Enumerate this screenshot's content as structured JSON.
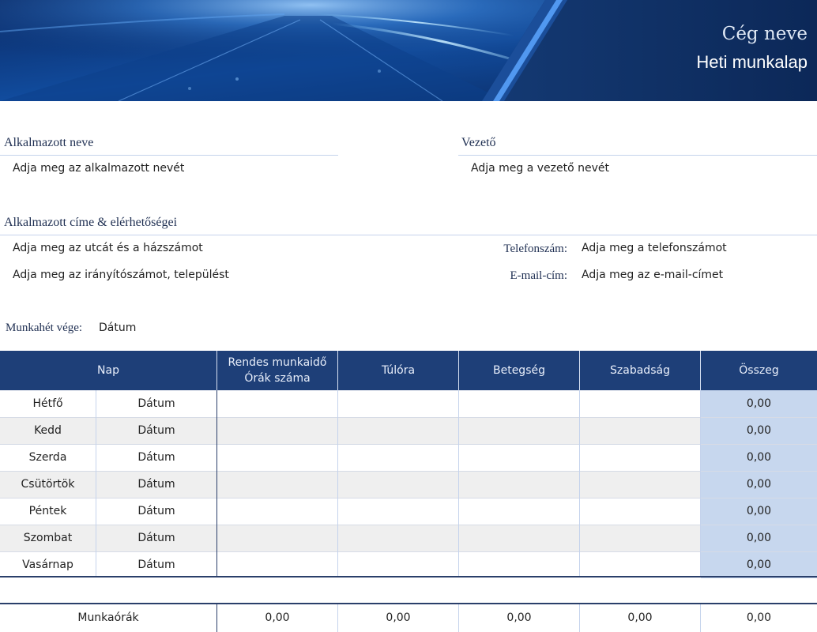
{
  "header": {
    "company_name": "Cég neve",
    "title": "Heti munkalap"
  },
  "employee": {
    "label": "Alkalmazott neve",
    "value": "Adja meg az alkalmazott nevét"
  },
  "manager": {
    "label": "Vezető",
    "value": "Adja meg a vezető nevét"
  },
  "contact": {
    "label": "Alkalmazott címe & elérhetőségei",
    "street": "Adja meg az utcát és a házszámot",
    "city": "Adja meg az irányítószámot, települést",
    "phone_label": "Telefonszám:",
    "phone_value": "Adja meg a telefonszámot",
    "email_label": "E-mail-cím:",
    "email_value": "Adja meg az e-mail-címet"
  },
  "week_end": {
    "label": "Munkahét vége:",
    "value": "Dátum"
  },
  "table": {
    "headers": {
      "day": "Nap",
      "regular_line1": "Rendes munkaidő",
      "regular_line2": "Órák száma",
      "overtime": "Túlóra",
      "sick": "Betegség",
      "vacation": "Szabadság",
      "total": "Összeg"
    },
    "rows": [
      {
        "day": "Hétfő",
        "date": "Dátum",
        "regular": "",
        "overtime": "",
        "sick": "",
        "vacation": "",
        "total": "0,00"
      },
      {
        "day": "Kedd",
        "date": "Dátum",
        "regular": "",
        "overtime": "",
        "sick": "",
        "vacation": "",
        "total": "0,00"
      },
      {
        "day": "Szerda",
        "date": "Dátum",
        "regular": "",
        "overtime": "",
        "sick": "",
        "vacation": "",
        "total": "0,00"
      },
      {
        "day": "Csütörtök",
        "date": "Dátum",
        "regular": "",
        "overtime": "",
        "sick": "",
        "vacation": "",
        "total": "0,00"
      },
      {
        "day": "Péntek",
        "date": "Dátum",
        "regular": "",
        "overtime": "",
        "sick": "",
        "vacation": "",
        "total": "0,00"
      },
      {
        "day": "Szombat",
        "date": "Dátum",
        "regular": "",
        "overtime": "",
        "sick": "",
        "vacation": "",
        "total": "0,00"
      },
      {
        "day": "Vasárnap",
        "date": "Dátum",
        "regular": "",
        "overtime": "",
        "sick": "",
        "vacation": "",
        "total": "0,00"
      }
    ],
    "summary": {
      "label": "Munkaórák",
      "regular": "0,00",
      "overtime": "0,00",
      "sick": "0,00",
      "vacation": "0,00",
      "total": "0,00"
    }
  },
  "colors": {
    "header_blue": "#1e3f78",
    "total_fill": "#c7d7ee",
    "alt_row": "#efefef"
  }
}
